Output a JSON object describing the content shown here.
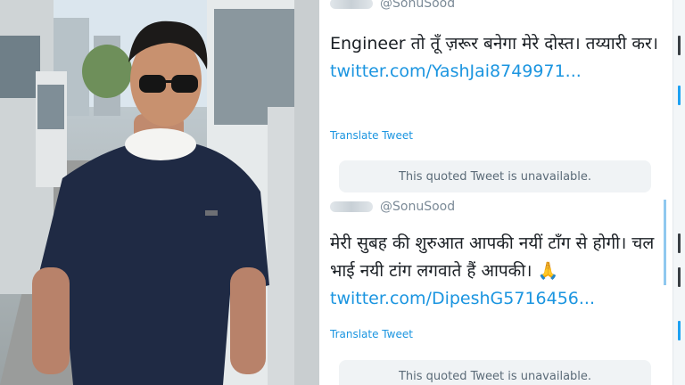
{
  "tweet_top": {
    "handle": "@SonuSood",
    "text": "Engineer तो तूँ ज़रूर बनेगा मेरे दोस्त। तय्यारी कर।",
    "link": "twitter.com/YashJai8749971...",
    "translate_label": "Translate Tweet",
    "quoted_unavailable": "This quoted Tweet is unavailable."
  },
  "tweet_bottom": {
    "handle": "@SonuSood",
    "text": "मेरी सुबह की शुरुआत आपकी नयीं टाँग से होगी। चल भाई नयी टांग लगवाते हैं आपकी।",
    "emoji": "🙏",
    "link": "twitter.com/DipeshG5716456...",
    "translate_label": "Translate Tweet",
    "quoted_unavailable": "This quoted Tweet is unavailable."
  },
  "colors": {
    "link": "#1b95e0",
    "shirt": "#1f2a44",
    "background": "#ffffff"
  }
}
